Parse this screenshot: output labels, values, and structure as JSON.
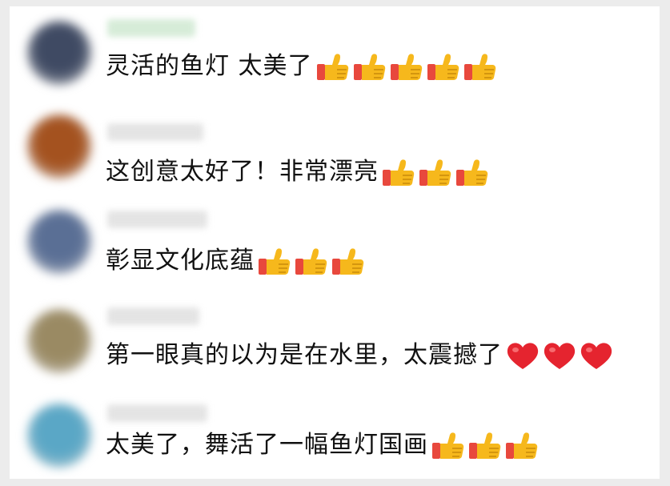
{
  "comments": [
    {
      "text": "灵活的鱼灯 太美了",
      "reaction_icon": "thumbs-up-icon",
      "reaction_count": 5,
      "avatar_color": "#3f4a63"
    },
    {
      "text": "这创意太好了！非常漂亮",
      "reaction_icon": "thumbs-up-icon",
      "reaction_count": 3,
      "avatar_color": "#a4521f"
    },
    {
      "text": "彰显文化底蕴",
      "reaction_icon": "thumbs-up-icon",
      "reaction_count": 3,
      "avatar_color": "#5a6f95"
    },
    {
      "text": "第一眼真的以为是在水里，太震撼了",
      "reaction_icon": "red-heart-icon",
      "reaction_count": 3,
      "avatar_color": "#9a8a63"
    },
    {
      "text": "太美了，舞活了一幅鱼灯国画",
      "reaction_icon": "thumbs-up-icon",
      "reaction_count": 3,
      "avatar_color": "#5aa7c6"
    }
  ],
  "colors": {
    "thumb_yellow": "#f6b81c",
    "cuff_red": "#e8483d",
    "heart_red": "#e5242f",
    "background": "#ececec"
  }
}
